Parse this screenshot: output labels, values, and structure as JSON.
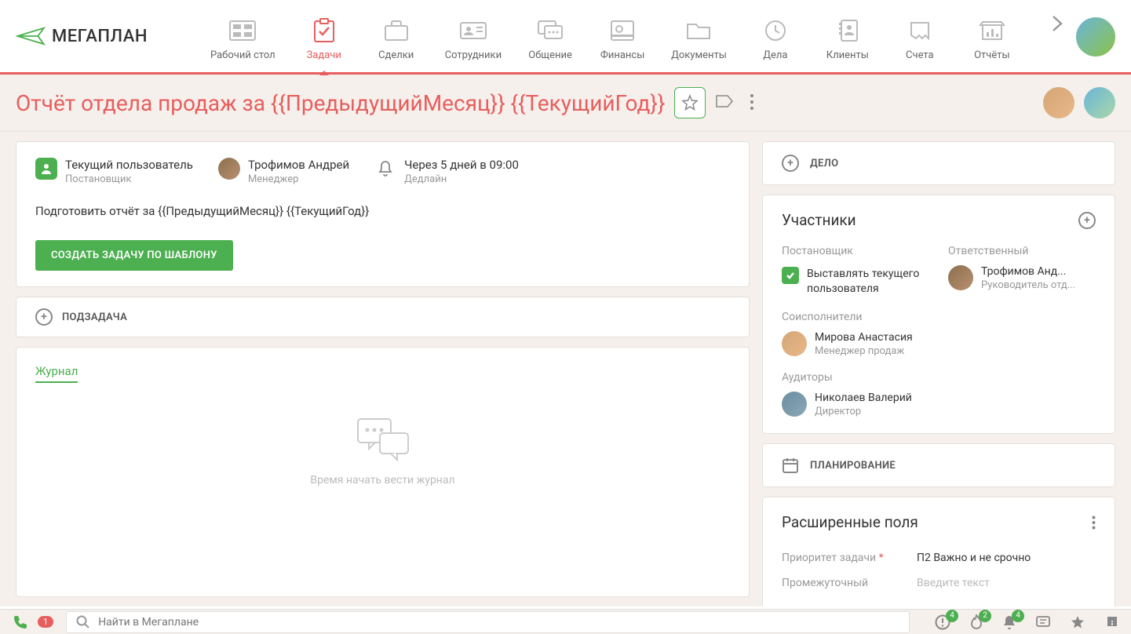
{
  "logo": "МЕГАПЛАН",
  "nav": {
    "items": [
      {
        "label": "Рабочий стол"
      },
      {
        "label": "Задачи"
      },
      {
        "label": "Сделки"
      },
      {
        "label": "Сотрудники"
      },
      {
        "label": "Общение"
      },
      {
        "label": "Финансы"
      },
      {
        "label": "Документы"
      },
      {
        "label": "Дела"
      },
      {
        "label": "Клиенты"
      },
      {
        "label": "Счета"
      },
      {
        "label": "Отчёты"
      }
    ],
    "active_index": 1
  },
  "title": "Отчёт отдела продаж за {{ПредыдущийМесяц}} {{ТекущийГод}}",
  "task": {
    "owner": {
      "name": "Текущий пользователь",
      "role": "Постановщик"
    },
    "manager": {
      "name": "Трофимов Андрей",
      "role": "Менеджер"
    },
    "deadline": {
      "text": "Через 5 дней в 09:00",
      "label": "Дедлайн"
    },
    "description": "Подготовить отчёт за {{ПредыдущийМесяц}} {{ТекущийГод}}",
    "create_button": "СОЗДАТЬ ЗАДАЧУ ПО ШАБЛОНУ"
  },
  "subtask_label": "ПОДЗАДАЧА",
  "journal": {
    "tab": "Журнал",
    "empty_text": "Время начать вести журнал"
  },
  "sidebar": {
    "delo_label": "ДЕЛО",
    "participants_title": "Участники",
    "owner_label": "Постановщик",
    "owner_check_text": "Выставлять текущего пользователя",
    "responsible_label": "Ответственный",
    "responsible": {
      "name": "Трофимов Анд...",
      "role": "Руководитель отд..."
    },
    "coexecutors_label": "Соисполнители",
    "coexecutor": {
      "name": "Мирова Анастасия",
      "role": "Менеджер продаж"
    },
    "auditors_label": "Аудиторы",
    "auditor": {
      "name": "Николаев Валерий",
      "role": "Директор"
    },
    "planning_label": "ПЛАНИРОВАНИЕ",
    "ext_title": "Расширенные поля",
    "ext_fields": {
      "priority_label": "Приоритет задачи",
      "priority_value": "П2 Важно и не срочно",
      "intermediate_label": "Промежуточный",
      "intermediate_placeholder": "Введите текст"
    }
  },
  "bottombar": {
    "phone_badge": "1",
    "search_placeholder": "Найти в Мегаплане",
    "counts": {
      "alert": "4",
      "fire": "2",
      "bell": "4"
    }
  }
}
